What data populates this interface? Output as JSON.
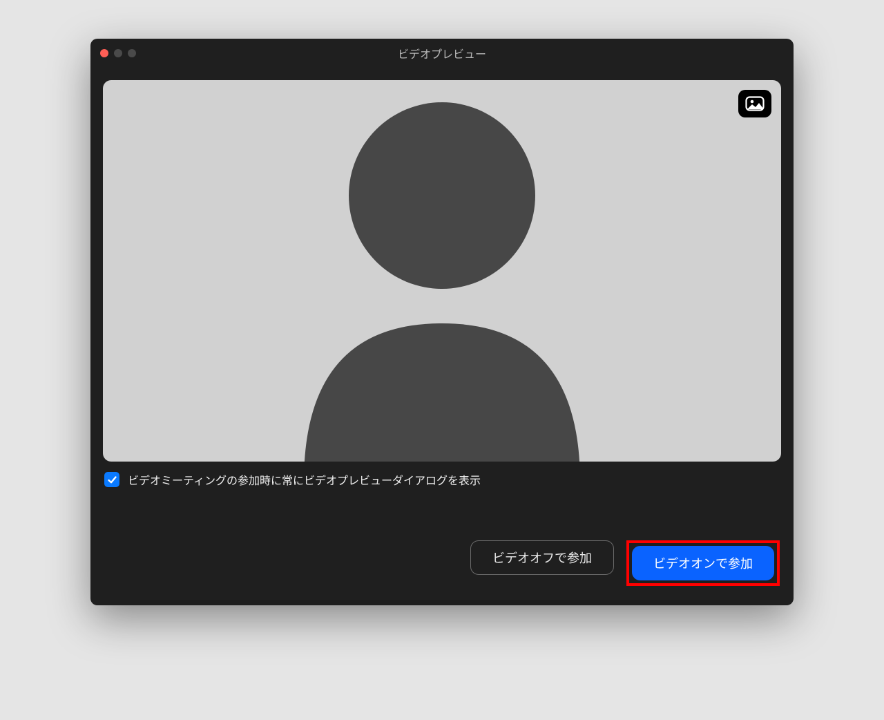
{
  "window": {
    "title": "ビデオプレビュー"
  },
  "preview": {
    "image_button_name": "virtual-background"
  },
  "checkbox": {
    "checked": true,
    "label": "ビデオミーティングの参加時に常にビデオプレビューダイアログを表示"
  },
  "buttons": {
    "video_off": "ビデオオフで参加",
    "video_on": "ビデオオンで参加"
  }
}
